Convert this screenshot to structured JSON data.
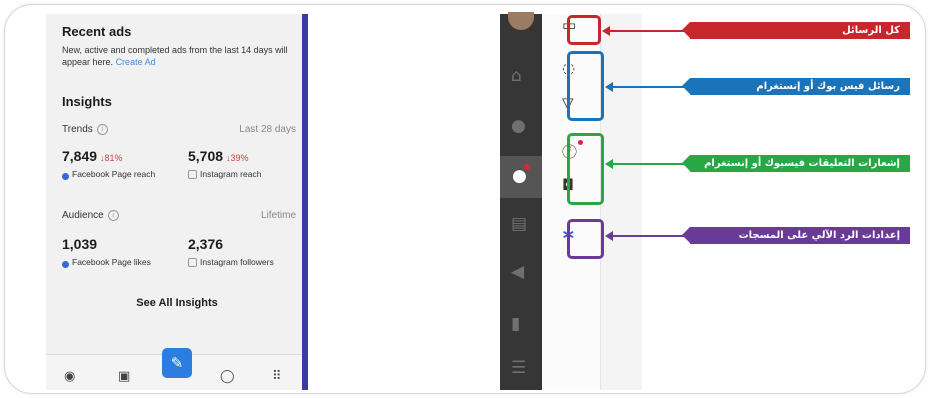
{
  "phone": {
    "recent_title": "Recent ads",
    "recent_desc": "New, active and completed ads from the last 14 days will appear here.",
    "recent_link": "Create Ad",
    "insights_title": "Insights",
    "trends_label": "Trends",
    "trends_period": "Last 28 days",
    "fb_reach_value": "7,849",
    "fb_reach_change": "↓81%",
    "fb_reach_label": "Facebook Page reach",
    "ig_reach_value": "5,708",
    "ig_reach_change": "↓39%",
    "ig_reach_label": "Instagram reach",
    "audience_label": "Audience",
    "audience_period": "Lifetime",
    "fb_likes_value": "1,039",
    "fb_likes_label": "Facebook Page likes",
    "ig_followers_value": "2,376",
    "ig_followers_label": "Instagram followers",
    "see_all": "See All Insights"
  },
  "annotations": [
    {
      "label": "كل الرسائل",
      "color": "#c8262c"
    },
    {
      "label": "رسائل فيس بوك أو إنستغرام",
      "color": "#1b73b9"
    },
    {
      "label": "إشعارات التعليقات فيسبوك أو إنستغرام",
      "color": "#27a844"
    },
    {
      "label": "إعدادات الرد الآلي على المسجات",
      "color": "#6a3a99"
    }
  ],
  "icons": {
    "all_messages": "chat-bubbles-icon",
    "messenger": "messenger-icon",
    "instagram_direct": "send-icon",
    "facebook": "facebook-icon",
    "instagram": "instagram-icon",
    "automation": "automation-icon"
  }
}
